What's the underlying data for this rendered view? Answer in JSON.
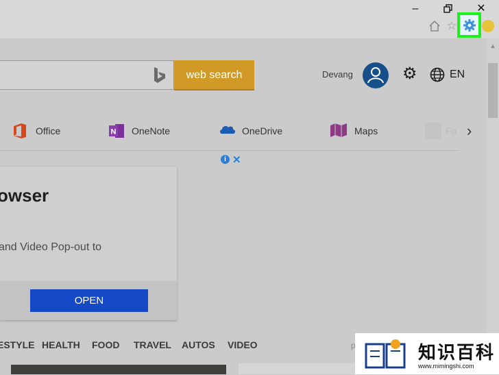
{
  "search": {
    "button_label": "web search",
    "placeholder": ""
  },
  "account": {
    "username": "Devang"
  },
  "header": {
    "language": "EN"
  },
  "quick_links": [
    {
      "label": "Office",
      "icon": "office-icon"
    },
    {
      "label": "OneNote",
      "icon": "onenote-icon"
    },
    {
      "label": "OneDrive",
      "icon": "onedrive-icon"
    },
    {
      "label": "Maps",
      "icon": "maps-icon"
    },
    {
      "label": "Fa",
      "icon": "facebook-icon"
    }
  ],
  "ad": {
    "title": "owser",
    "body": "and Video Pop-out to",
    "cta": "OPEN"
  },
  "categories": [
    "ESTYLE",
    "HEALTH",
    "FOOD",
    "TRAVEL",
    "AUTOS",
    "VIDEO"
  ],
  "categories_more": "p",
  "watermark": {
    "text": "知识百科",
    "url": "www.mimingshi.com"
  },
  "colors": {
    "highlight": "#1ef01e",
    "search_button": "#d19a26",
    "open_button": "#1548c4",
    "avatar": "#164f8a"
  }
}
